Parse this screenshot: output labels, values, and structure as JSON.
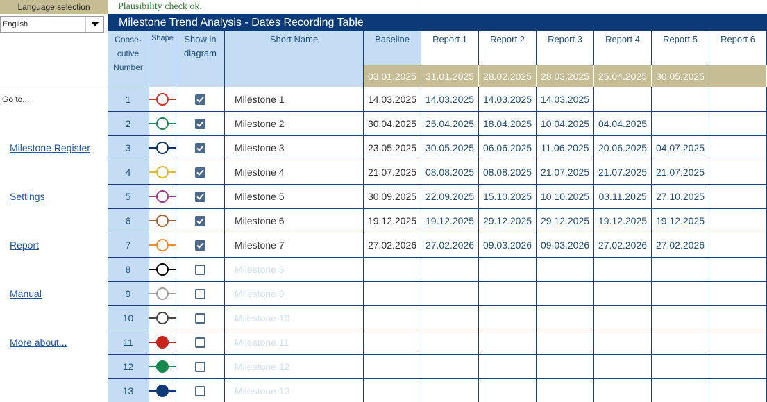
{
  "sidebar": {
    "language_label": "Language selection",
    "language_value": "English",
    "goto_label": "Go to...",
    "links": [
      "Milestone Register",
      "Settings",
      "Report",
      "Manual",
      "More about..."
    ]
  },
  "status": {
    "plausibility": "Plausibility check ok."
  },
  "title": "Milestone Trend Analysis - Dates Recording Table",
  "headers": {
    "number": "Conse- cutive Number",
    "shape": "Shape",
    "show": "Show in diagram",
    "name": "Short Name",
    "reports": [
      "Baseline",
      "Report 1",
      "Report 2",
      "Report 3",
      "Report 4",
      "Report 5",
      "Report 6"
    ],
    "report_dates": [
      "03.01.2025",
      "31.01.2025",
      "28.02.2025",
      "28.03.2025",
      "25.04.2025",
      "30.05.2025",
      ""
    ]
  },
  "colors": {
    "title_bar": "#0c3a78",
    "header_blue": "#c5dcf5",
    "date_band": "#c6bd94",
    "link": "#1f56a8",
    "plausibility_ok": "#2e7d32"
  },
  "milestones": [
    {
      "num": "1",
      "name": "Milestone 1",
      "shown": true,
      "shape_color": "#d62b2b",
      "filled": false,
      "dates": [
        "14.03.2025",
        "14.03.2025",
        "14.03.2025",
        "14.03.2025",
        "",
        "",
        ""
      ]
    },
    {
      "num": "2",
      "name": "Milestone 2",
      "shown": true,
      "shape_color": "#1a8a5a",
      "filled": false,
      "dates": [
        "30.04.2025",
        "25.04.2025",
        "18.04.2025",
        "10.04.2025",
        "04.04.2025",
        "",
        ""
      ]
    },
    {
      "num": "3",
      "name": "Milestone 3",
      "shown": true,
      "shape_color": "#0e2f6b",
      "filled": false,
      "dates": [
        "23.05.2025",
        "30.05.2025",
        "06.06.2025",
        "11.06.2025",
        "20.06.2025",
        "04.07.2025",
        ""
      ]
    },
    {
      "num": "4",
      "name": "Milestone 4",
      "shown": true,
      "shape_color": "#e9b72a",
      "filled": false,
      "dates": [
        "21.07.2025",
        "08.08.2025",
        "08.08.2025",
        "21.07.2025",
        "21.07.2025",
        "21.07.2025",
        ""
      ]
    },
    {
      "num": "5",
      "name": "Milestone 5",
      "shown": true,
      "shape_color": "#9b3a8f",
      "filled": false,
      "dates": [
        "30.09.2025",
        "22.09.2025",
        "15.10.2025",
        "10.10.2025",
        "03.11.2025",
        "27.10.2025",
        ""
      ]
    },
    {
      "num": "6",
      "name": "Milestone 6",
      "shown": true,
      "shape_color": "#a5612f",
      "filled": false,
      "dates": [
        "19.12.2025",
        "19.12.2025",
        "29.12.2025",
        "29.12.2025",
        "19.12.2025",
        "19.12.2025",
        ""
      ]
    },
    {
      "num": "7",
      "name": "Milestone 7",
      "shown": true,
      "shape_color": "#f08a2a",
      "filled": false,
      "dates": [
        "27.02.2026",
        "27.02.2026",
        "09.03.2026",
        "09.03.2026",
        "27.02.2026",
        "27.02.2026",
        ""
      ]
    },
    {
      "num": "8",
      "name": "Milestone 8",
      "shown": false,
      "shape_color": "#000000",
      "filled": false,
      "dates": [
        "",
        "",
        "",
        "",
        "",
        "",
        ""
      ]
    },
    {
      "num": "9",
      "name": "Milestone 9",
      "shown": false,
      "shape_color": "#9e9e9e",
      "filled": false,
      "dates": [
        "",
        "",
        "",
        "",
        "",
        "",
        ""
      ]
    },
    {
      "num": "10",
      "name": "Milestone 10",
      "shown": false,
      "shape_color": "#454545",
      "filled": false,
      "dates": [
        "",
        "",
        "",
        "",
        "",
        "",
        ""
      ]
    },
    {
      "num": "11",
      "name": "Milestone 11",
      "shown": false,
      "shape_color": "#c8231d",
      "filled": true,
      "dates": [
        "",
        "",
        "",
        "",
        "",
        "",
        ""
      ]
    },
    {
      "num": "12",
      "name": "Milestone 12",
      "shown": false,
      "shape_color": "#168a4e",
      "filled": true,
      "dates": [
        "",
        "",
        "",
        "",
        "",
        "",
        ""
      ]
    },
    {
      "num": "13",
      "name": "Milestone 13",
      "shown": false,
      "shape_color": "#0c3a78",
      "filled": true,
      "dates": [
        "",
        "",
        "",
        "",
        "",
        "",
        ""
      ]
    }
  ]
}
